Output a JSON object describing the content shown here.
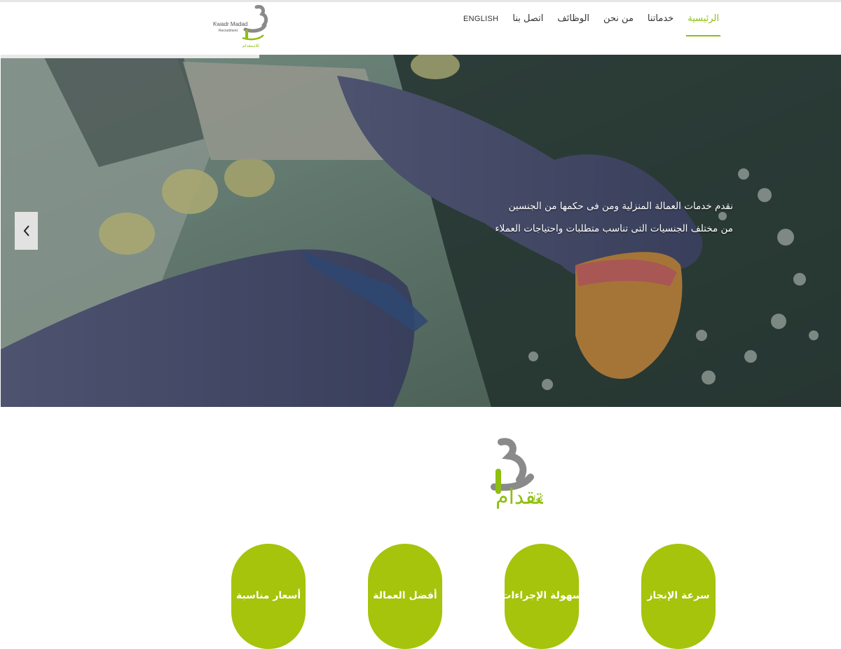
{
  "nav": {
    "items": [
      {
        "label": "الرئيسية",
        "active": true
      },
      {
        "label": "خدماتنا",
        "active": false
      },
      {
        "label": "من نحن",
        "active": false
      },
      {
        "label": "الوظائف",
        "active": false
      },
      {
        "label": "اتصل بنا",
        "active": false
      },
      {
        "label": "ENGLISH",
        "active": false
      }
    ]
  },
  "logo": {
    "english_name": "Kwadr Madad",
    "english_sub": "Recruitment",
    "arabic_sub": "للاستقدام"
  },
  "hero": {
    "caption_line1": "نقدم خدمات العمالة المنزلية ومن فى حكمها من الجنسين",
    "caption_line2": "من مختلف الجنسيات التى تناسب متطلبات واحتياجات العملاء",
    "prev_icon": "chevron-left-icon"
  },
  "brand": {
    "arabic_small": "كوادر",
    "arabic_large": "للاستقدام"
  },
  "features": [
    {
      "label": "سرعة الإنجاز"
    },
    {
      "label": "سهولة الإجراءات"
    },
    {
      "label": "أفضل العمالة"
    },
    {
      "label": "أسعار مناسبة"
    }
  ],
  "colors": {
    "accent": "#8ebf10",
    "circle": "#a5c40b",
    "logo_gray": "#8a8a8a"
  }
}
